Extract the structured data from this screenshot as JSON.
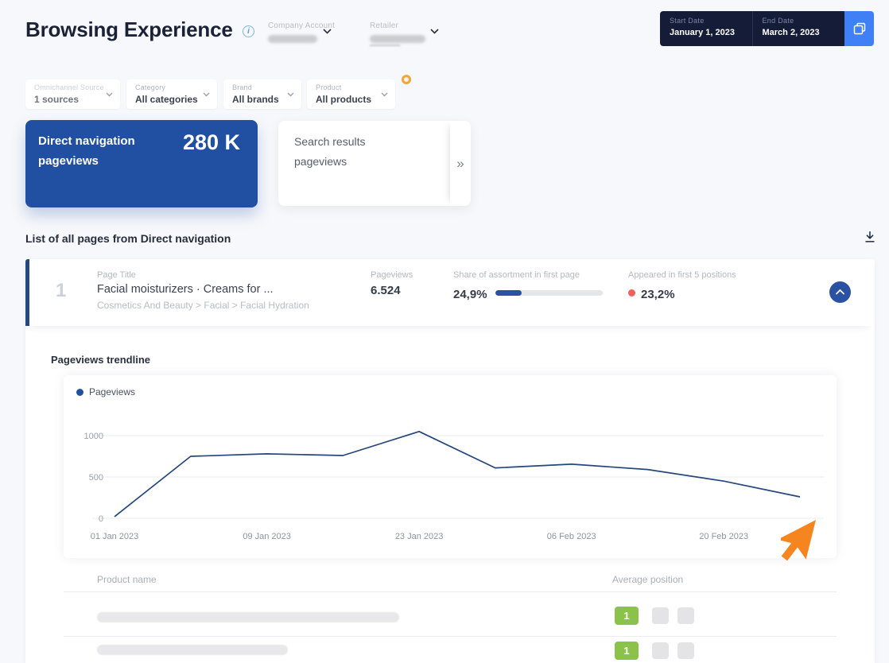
{
  "page": {
    "title": "Browsing Experience"
  },
  "header": {
    "company_account_label": "Company Account",
    "retailer_label": "Retailer",
    "date_range": {
      "start_label": "Start Date",
      "start_value": "January 1, 2023",
      "end_label": "End Date",
      "end_value": "March 2, 2023"
    }
  },
  "icons": {
    "info": "i",
    "expand": "»"
  },
  "filters": [
    {
      "label": "Omnichannel Source",
      "value": "1 sources"
    },
    {
      "label": "Category",
      "value": "All categories"
    },
    {
      "label": "Brand",
      "value": "All brands"
    },
    {
      "label": "Product",
      "value": "All products"
    }
  ],
  "metric_cards": {
    "direct": {
      "label": "Direct navigation pageviews",
      "value": "280 K"
    },
    "search": {
      "label": "Search results pageviews"
    }
  },
  "section": {
    "title": "List of all pages from Direct navigation"
  },
  "page_row": {
    "rank": "1",
    "page_title_label": "Page Title",
    "page_title": "Facial moisturizers · Creams for ...",
    "breadcrumb": "Cosmetics And Beauty > Facial > Facial Hydration",
    "pageviews_label": "Pageviews",
    "pageviews": "6.524",
    "share_label": "Share of assortment in first page",
    "share": "24,9%",
    "share_pct": 24.9,
    "appeared_label": "Appeared in first 5 positions",
    "appeared": "23,2%"
  },
  "trendline": {
    "title": "Pageviews trendline",
    "legend": "Pageviews"
  },
  "chart_data": {
    "type": "line",
    "title": "Pageviews trendline",
    "x": [
      "01 Jan 2023",
      "05 Jan 2023",
      "09 Jan 2023",
      "16 Jan 2023",
      "23 Jan 2023",
      "30 Jan 2023",
      "06 Feb 2023",
      "13 Feb 2023",
      "20 Feb 2023",
      "27 Feb 2023"
    ],
    "series": [
      {
        "name": "Pageviews",
        "values": [
          20,
          750,
          780,
          760,
          1050,
          610,
          655,
          590,
          450,
          260
        ]
      }
    ],
    "x_tick_labels": [
      "01 Jan 2023",
      "09 Jan 2023",
      "23 Jan 2023",
      "06 Feb 2023",
      "20 Feb 2023"
    ],
    "x_tick_indices": [
      0,
      2,
      4,
      6,
      8
    ],
    "y_ticks": [
      0,
      500,
      1000
    ],
    "ylim": [
      0,
      1150
    ],
    "grid": true,
    "legend_position": "top-left",
    "line_color": "#26477d"
  },
  "products_table": {
    "columns": [
      "Product name",
      "Average position"
    ],
    "rows": [
      {
        "position": "1"
      },
      {
        "position": "1"
      }
    ]
  },
  "colors": {
    "accent_blue": "#2150a3",
    "button_blue": "#3f80f7",
    "dark_navy": "#141c38",
    "line_navy": "#26477d",
    "green_badge": "#8bc34a",
    "red_dot": "#f2605e",
    "orange_cursor": "#f6851f",
    "warning_ring": "#f3a63b"
  }
}
